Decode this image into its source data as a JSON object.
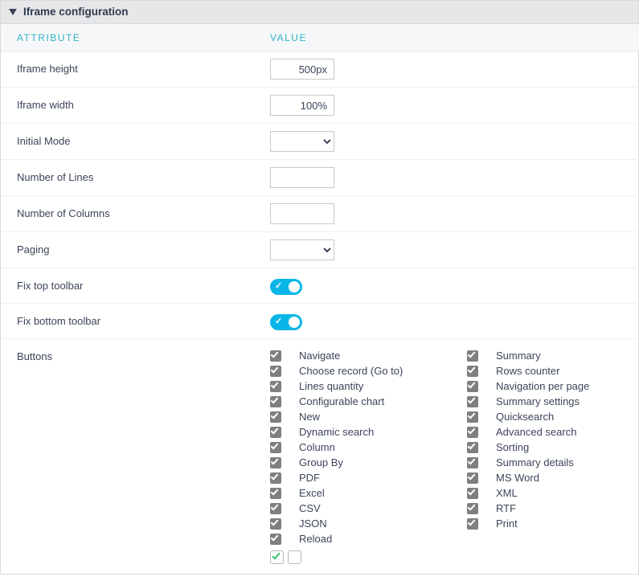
{
  "panel": {
    "title": "Iframe configuration"
  },
  "columns": {
    "attribute": "ATTRIBUTE",
    "value": "VALUE"
  },
  "rows": {
    "iframe_height": {
      "label": "Iframe height",
      "value": "500px"
    },
    "iframe_width": {
      "label": "Iframe width",
      "value": "100%"
    },
    "initial_mode": {
      "label": "Initial Mode",
      "value": ""
    },
    "num_lines": {
      "label": "Number of Lines",
      "value": ""
    },
    "num_columns": {
      "label": "Number of Columns",
      "value": ""
    },
    "paging": {
      "label": "Paging",
      "value": ""
    },
    "fix_top": {
      "label": "Fix top toolbar",
      "value": true
    },
    "fix_bottom": {
      "label": "Fix bottom toolbar",
      "value": true
    },
    "buttons": {
      "label": "Buttons"
    }
  },
  "buttons_left": [
    "Navigate",
    "Choose record (Go to)",
    "Lines quantity",
    "Configurable chart",
    "New",
    "Dynamic search",
    "Column",
    "Group By",
    "PDF",
    "Excel",
    "CSV",
    "JSON",
    "Reload"
  ],
  "buttons_right": [
    "Summary",
    "Rows counter",
    "Navigation per page",
    "Summary settings",
    "Quicksearch",
    "Advanced search",
    "Sorting",
    "Summary details",
    "MS Word",
    "XML",
    "RTF",
    "Print"
  ]
}
